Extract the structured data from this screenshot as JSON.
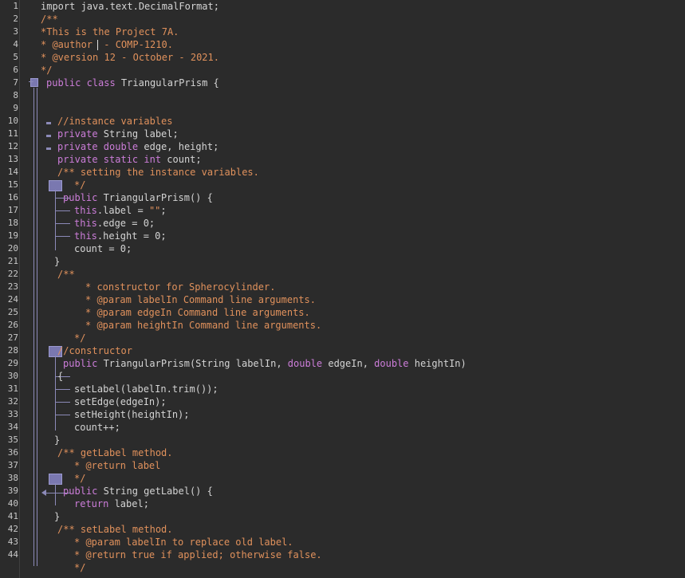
{
  "editor": {
    "language": "java",
    "line_numbers": [
      "1",
      "2",
      "3",
      "4",
      "5",
      "6",
      "7",
      "8",
      "9",
      "10",
      "11",
      "12",
      "13",
      "14",
      "15",
      "16",
      "17",
      "18",
      "19",
      "20",
      "21",
      "22",
      "23",
      "24",
      "25",
      "26",
      "27",
      "28",
      "29",
      "30",
      "31",
      "32",
      "33",
      "34",
      "35",
      "36",
      "37",
      "38",
      "39",
      "40",
      "41",
      "42",
      "43",
      "44"
    ],
    "lines": [
      [
        [
          "pl",
          "import java.text.DecimalFormat;"
        ]
      ],
      [
        [
          "cm",
          "/**"
        ]
      ],
      [
        [
          "cm",
          "*This is the Project 7A."
        ]
      ],
      [
        [
          "cm",
          "* @author "
        ],
        [
          "cm",
          "- COMP-1210."
        ]
      ],
      [
        [
          "cm",
          "* @version 12 - October - 2021."
        ]
      ],
      [
        [
          "cm",
          "*/"
        ]
      ],
      [
        [
          "kw",
          "public class "
        ],
        [
          "pl",
          "TriangularPrism {"
        ]
      ],
      [],
      [],
      [
        [
          "cm",
          "//instance variables"
        ]
      ],
      [
        [
          "kw",
          "private "
        ],
        [
          "pl",
          "String label;"
        ]
      ],
      [
        [
          "kw",
          "private double "
        ],
        [
          "pl",
          "edge, height;"
        ]
      ],
      [
        [
          "kw",
          "private static int "
        ],
        [
          "pl",
          "count;"
        ]
      ],
      [
        [
          "cm",
          "/** setting the instance variables."
        ]
      ],
      [
        [
          "cm",
          "*/"
        ]
      ],
      [
        [
          "kw",
          "public "
        ],
        [
          "pl",
          "TriangularPrism() {"
        ]
      ],
      [
        [
          "kw",
          "this"
        ],
        [
          "pl",
          ".label = "
        ],
        [
          "cm",
          "\"\""
        ],
        [
          "pl",
          ";"
        ]
      ],
      [
        [
          "kw",
          "this"
        ],
        [
          "pl",
          ".edge = 0;"
        ]
      ],
      [
        [
          "kw",
          "this"
        ],
        [
          "pl",
          ".height = 0;"
        ]
      ],
      [
        [
          "pl",
          "count = 0;"
        ]
      ],
      [
        [
          "pl",
          "}"
        ]
      ],
      [
        [
          "cm",
          "/**"
        ]
      ],
      [
        [
          "cm",
          "* constructor for Spherocylinder."
        ]
      ],
      [
        [
          "cm",
          "* @param labelIn Command line arguments."
        ]
      ],
      [
        [
          "cm",
          "* @param edgeIn Command line arguments."
        ]
      ],
      [
        [
          "cm",
          "* @param heightIn Command line arguments."
        ]
      ],
      [
        [
          "cm",
          "*/"
        ]
      ],
      [
        [
          "cm",
          "//constructor"
        ]
      ],
      [
        [
          "kw",
          "public "
        ],
        [
          "pl",
          "TriangularPrism(String labelIn, "
        ],
        [
          "kw",
          "double "
        ],
        [
          "pl",
          "edgeIn, "
        ],
        [
          "kw",
          "double "
        ],
        [
          "pl",
          "heightIn)"
        ]
      ],
      [
        [
          "pl",
          "{"
        ]
      ],
      [
        [
          "pl",
          "setLabel(labelIn.trim());"
        ]
      ],
      [
        [
          "pl",
          "setEdge(edgeIn);"
        ]
      ],
      [
        [
          "pl",
          "setHeight(heightIn);"
        ]
      ],
      [
        [
          "pl",
          "count++;"
        ]
      ],
      [
        [
          "pl",
          "}"
        ]
      ],
      [
        [
          "cm",
          "/** getLabel method."
        ]
      ],
      [
        [
          "cm",
          "* @return label"
        ]
      ],
      [
        [
          "cm",
          "*/"
        ]
      ],
      [
        [
          "kw",
          "public "
        ],
        [
          "pl",
          "String getLabel() {"
        ]
      ],
      [
        [
          "kw",
          "return "
        ],
        [
          "pl",
          "label;"
        ]
      ],
      [
        [
          "pl",
          "}"
        ]
      ],
      [
        [
          "cm",
          "/** setLabel method."
        ]
      ],
      [
        [
          "cm",
          "* @param labelIn to replace old label."
        ]
      ],
      [
        [
          "cm",
          "* @return true if applied; otherwise false."
        ]
      ],
      [
        [
          "cm",
          "*/"
        ]
      ]
    ]
  },
  "colors": {
    "background": "#2b2b2b",
    "keyword": "#cc7dd9",
    "comment": "#e0915c",
    "plain": "#d4d4d4",
    "line_number": "#c8c8c8",
    "structure_guide": "#8c8ab8"
  }
}
